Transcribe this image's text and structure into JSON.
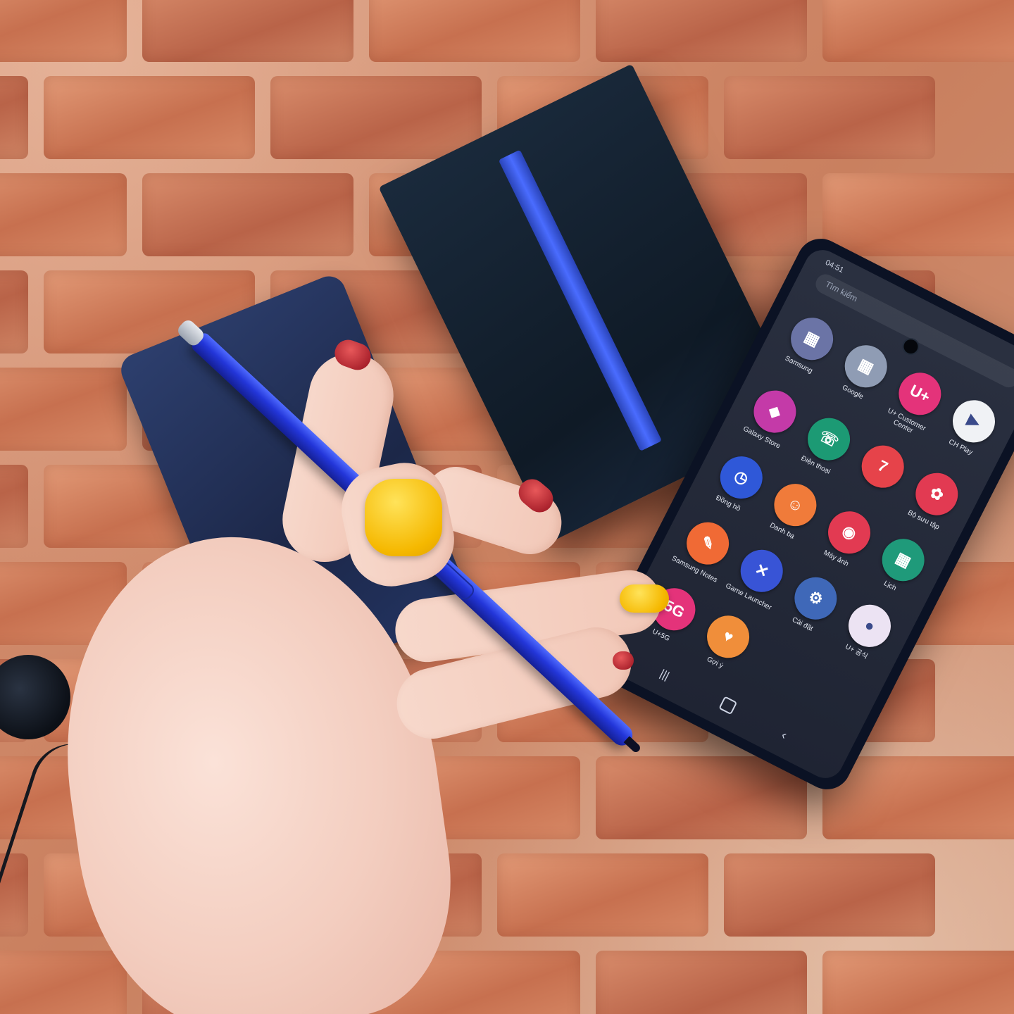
{
  "phone_screen": {
    "search_placeholder": "Tìm kiếm",
    "status_time": "04:51",
    "apps": [
      {
        "label": "Samsung",
        "color": "#6b74a6",
        "glyph": "▦"
      },
      {
        "label": "Google",
        "color": "#8f9cb4",
        "glyph": "▦"
      },
      {
        "label": "U+ Customer Center",
        "color": "#e4337a",
        "glyph": "U+"
      },
      {
        "label": "CH Play",
        "color": "#f0f2f5",
        "glyph": "▶"
      },
      {
        "label": "Galaxy Store",
        "color": "#c43aa8",
        "glyph": "◆"
      },
      {
        "label": "Điện thoại",
        "color": "#1c9a74",
        "glyph": "☏"
      },
      {
        "label": "",
        "color": "#e6434a",
        "glyph": "7"
      },
      {
        "label": "Bộ sưu tập",
        "color": "#e23a52",
        "glyph": "✿"
      },
      {
        "label": "Đồng hồ",
        "color": "#2f58d8",
        "glyph": "◷"
      },
      {
        "label": "Danh bạ",
        "color": "#f07b3a",
        "glyph": "☺"
      },
      {
        "label": "Máy ảnh",
        "color": "#e23a52",
        "glyph": "◉"
      },
      {
        "label": "Lịch",
        "color": "#1f9a7a",
        "glyph": "▦"
      },
      {
        "label": "Samsung Notes",
        "color": "#f06a35",
        "glyph": "✎"
      },
      {
        "label": "Game Launcher",
        "color": "#3854d6",
        "glyph": "✕"
      },
      {
        "label": "Cài đặt",
        "color": "#3f68b8",
        "glyph": "⚙"
      },
      {
        "label": "U+ 공식",
        "color": "#ece3f3",
        "glyph": "●"
      },
      {
        "label": "U+5G",
        "color": "#e4337a",
        "glyph": "5G"
      },
      {
        "label": "Gợi ý",
        "color": "#f08e3a",
        "glyph": "♥"
      }
    ]
  }
}
